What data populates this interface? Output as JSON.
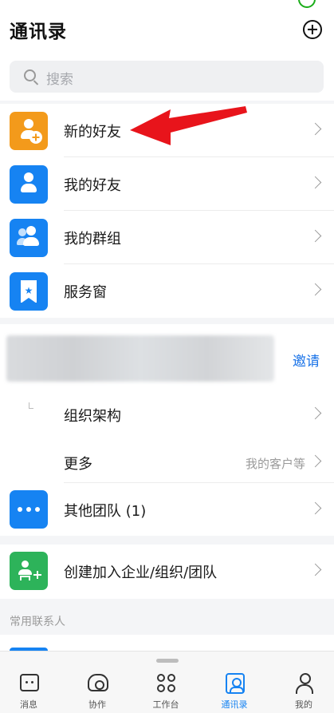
{
  "header": {
    "title": "通讯录",
    "add_icon": "plus-circle-icon"
  },
  "search": {
    "placeholder": "搜索",
    "icon": "search-icon"
  },
  "menu": {
    "items": [
      {
        "label": "新的好友",
        "icon": "add-friend-icon",
        "color": "#f39a1b"
      },
      {
        "label": "我的好友",
        "icon": "user-icon",
        "color": "#1683f2"
      },
      {
        "label": "我的群组",
        "icon": "group-icon",
        "color": "#1683f2"
      },
      {
        "label": "服务窗",
        "icon": "star-badge-icon",
        "color": "#1683f2"
      }
    ]
  },
  "org": {
    "invite_label": "邀请",
    "items": [
      {
        "label": "组织架构"
      },
      {
        "label": "更多",
        "sub": "我的客户等"
      },
      {
        "label": "其他团队 (1)",
        "icon": "more-dots-icon",
        "color": "#1683f2"
      }
    ]
  },
  "create": {
    "label": "创建加入企业/组织/团队",
    "icon": "create-org-icon",
    "color": "#2db35a"
  },
  "section": {
    "frequent_label": "常用联系人"
  },
  "tabbar": {
    "tabs": [
      {
        "label": "消息",
        "icon": "message-icon"
      },
      {
        "label": "协作",
        "icon": "cloud-icon"
      },
      {
        "label": "工作台",
        "icon": "grid-icon"
      },
      {
        "label": "通讯录",
        "icon": "contacts-icon",
        "active": true
      },
      {
        "label": "我的",
        "icon": "profile-icon"
      }
    ]
  },
  "colors": {
    "accent": "#1683f2",
    "annotation_arrow": "#e8141b"
  }
}
